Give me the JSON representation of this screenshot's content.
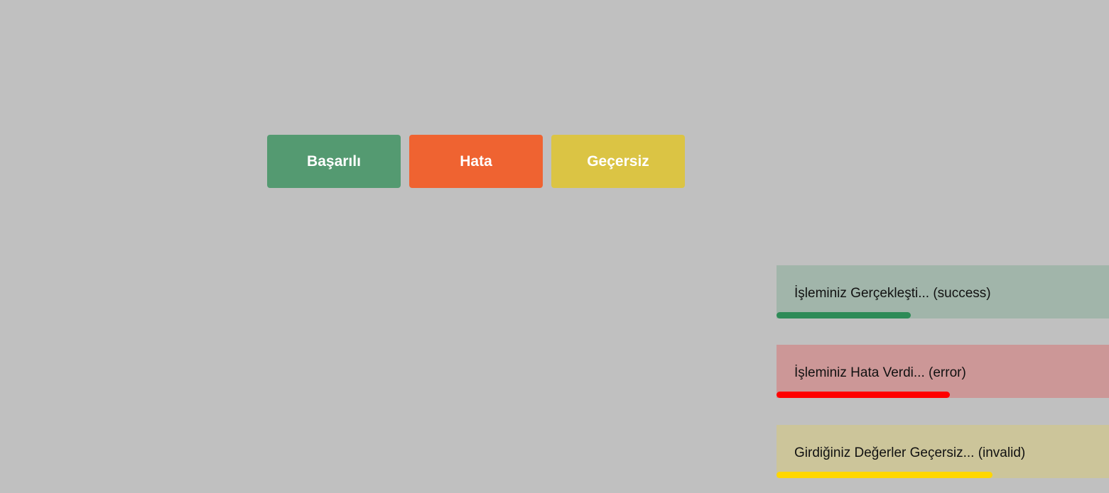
{
  "buttons": {
    "success": {
      "label": "Başarılı",
      "color": "#549a71"
    },
    "error": {
      "label": "Hata",
      "color": "#ef6331"
    },
    "invalid": {
      "label": "Geçersiz",
      "color": "#dbc444"
    }
  },
  "toasts": [
    {
      "type": "success",
      "message": "İşleminiz Gerçekleşti... (success)",
      "background": "#a1b5aa",
      "progress_color": "#2e8b57",
      "remaining_fraction": 0.4
    },
    {
      "type": "error",
      "message": "İşleminiz Hata Verdi... (error)",
      "background": "#cc9797",
      "progress_color": "#ff0000",
      "remaining_fraction": 0.52
    },
    {
      "type": "invalid",
      "message": "Girdiğiniz Değerler Geçersiz... (invalid)",
      "background": "#ccc59a",
      "progress_color": "#ffd700",
      "remaining_fraction": 0.65
    }
  ]
}
